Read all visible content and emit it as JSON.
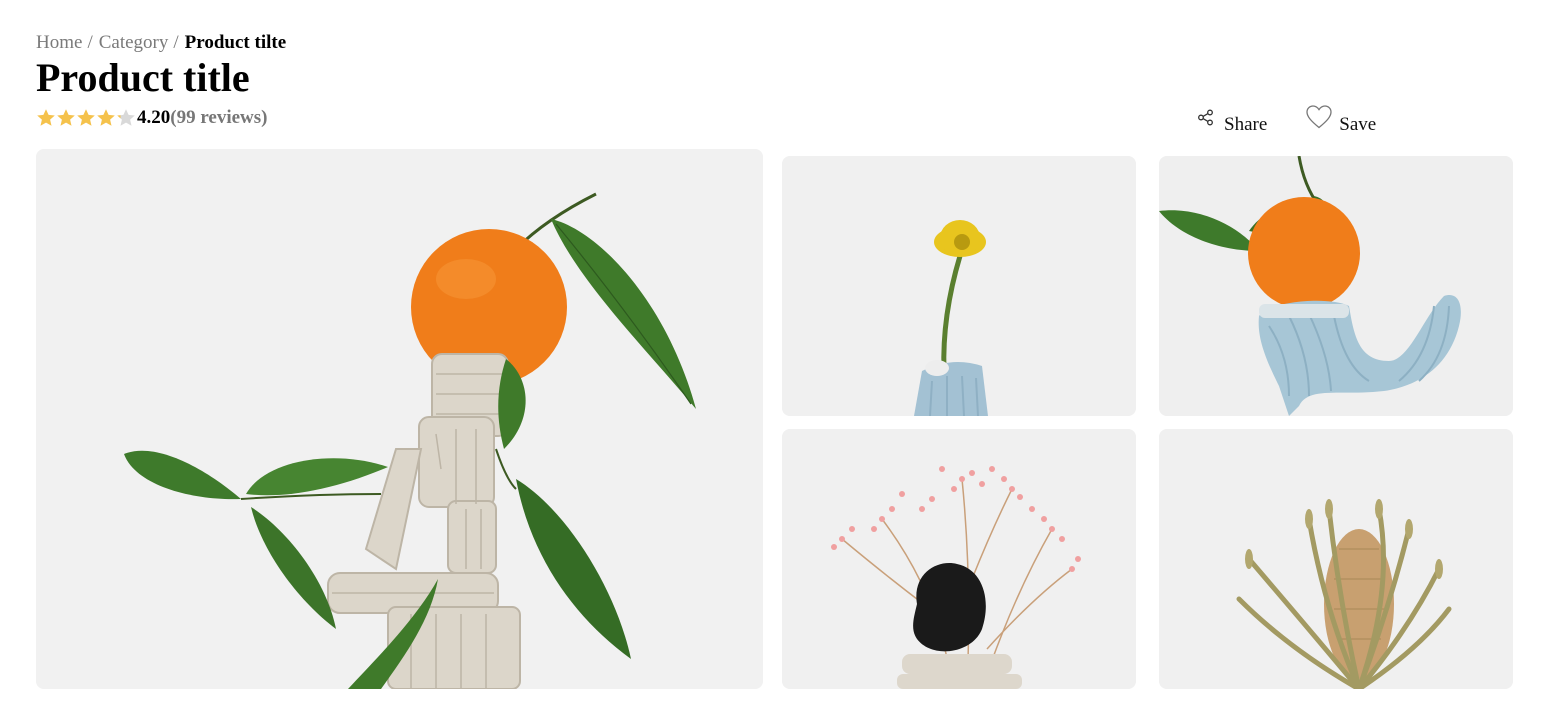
{
  "breadcrumb": {
    "items": [
      "Home",
      "Category"
    ],
    "separator": "/",
    "current": "Product tilte"
  },
  "product": {
    "title": "Product title",
    "rating": {
      "stars": 4.2,
      "max_stars": 5,
      "value": "4.20",
      "reviews": "(99 reviews)",
      "star_color": "#f5c24c",
      "star_empty_color": "#d9d9d9"
    }
  },
  "actions": {
    "share": {
      "label": "Share",
      "icon": "share-icon"
    },
    "save": {
      "label": "Save",
      "icon": "heart-outline-icon"
    }
  },
  "gallery": {
    "images": [
      {
        "subject": "main-orange-clay-sculpture"
      },
      {
        "subject": "yellow-flower-blue-vase"
      },
      {
        "subject": "orange-on-blue-clay-arch"
      },
      {
        "subject": "pink-dried-flowers-black-stone"
      },
      {
        "subject": "dried-banksia-flower"
      }
    ]
  }
}
